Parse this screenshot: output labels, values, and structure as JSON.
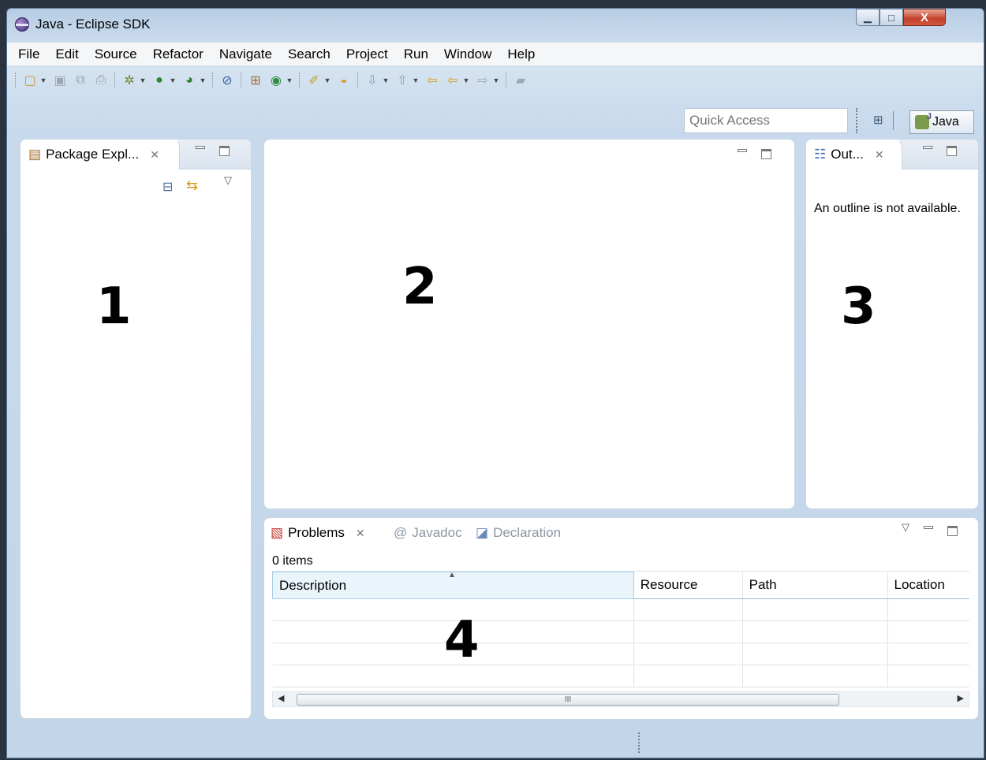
{
  "window": {
    "title": "Java - Eclipse SDK"
  },
  "menu": [
    "File",
    "Edit",
    "Source",
    "Refactor",
    "Navigate",
    "Search",
    "Project",
    "Run",
    "Window",
    "Help"
  ],
  "toolbar": {
    "quick_access_placeholder": "Quick Access",
    "perspective_label": "Java"
  },
  "package_explorer": {
    "tab_label": "Package Expl...",
    "region_number": "1"
  },
  "editor": {
    "region_number": "2"
  },
  "outline": {
    "tab_label": "Out...",
    "message": "An outline is not available.",
    "region_number": "3"
  },
  "problems": {
    "tabs": [
      {
        "label": "Problems"
      },
      {
        "label": "Javadoc"
      },
      {
        "label": "Declaration"
      }
    ],
    "item_count": "0 items",
    "columns": [
      "Description",
      "Resource",
      "Path",
      "Location"
    ],
    "region_number": "4",
    "scroll_thumb_label": "III"
  },
  "colors": {
    "accent": "#c6d8eb",
    "close_button": "#c4402a"
  }
}
